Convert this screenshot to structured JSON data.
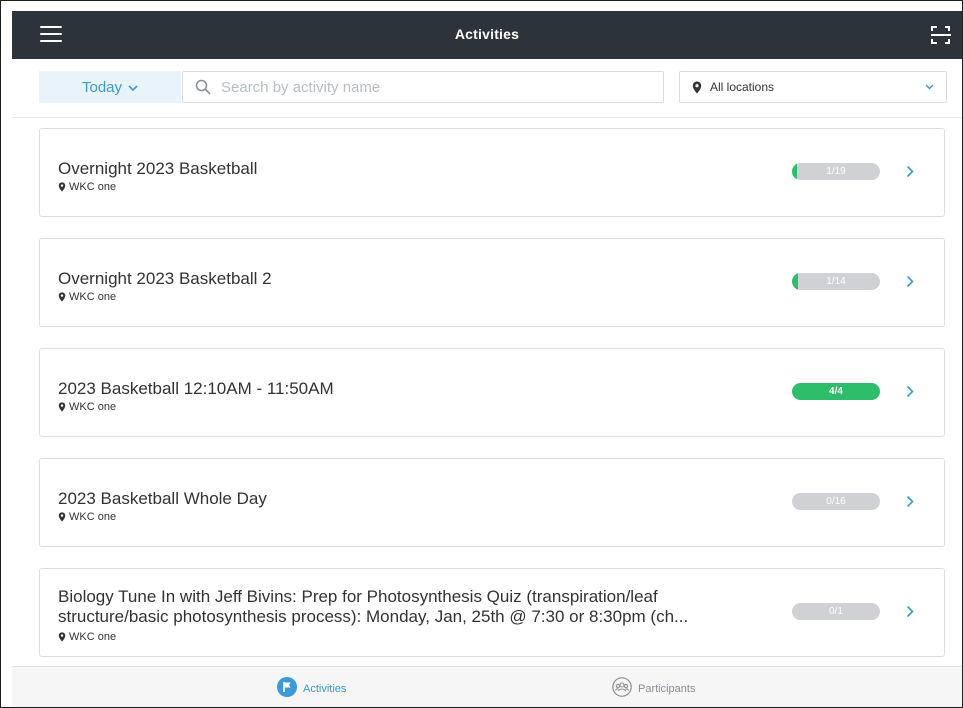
{
  "header": {
    "title": "Activities"
  },
  "filters": {
    "date_label": "Today",
    "search_placeholder": "Search by activity name",
    "location_label": "All locations"
  },
  "activities": [
    {
      "name": "Overnight 2023 Basketball",
      "location": "WKC one",
      "count": "1/19",
      "filled": 1,
      "capacity": 19
    },
    {
      "name": "Overnight 2023 Basketball 2",
      "location": "WKC one",
      "count": "1/14",
      "filled": 1,
      "capacity": 14
    },
    {
      "name": "2023 Basketball 12:10AM - 11:50AM",
      "location": "WKC one",
      "count": "4/4",
      "filled": 4,
      "capacity": 4
    },
    {
      "name": "2023 Basketball Whole Day",
      "location": "WKC one",
      "count": "0/16",
      "filled": 0,
      "capacity": 16
    },
    {
      "name": "Biology Tune In with Jeff Bivins: Prep for Photosynthesis Quiz (transpiration/leaf structure/basic photosynthesis process): Monday, Jan, 25th @ 7:30 or 8:30pm (ch...",
      "location": "WKC one",
      "count": "0/1",
      "filled": 0,
      "capacity": 1
    }
  ],
  "tabs": [
    {
      "label": "Activities",
      "icon": "flag-icon",
      "active": true
    },
    {
      "label": "Participants",
      "icon": "group-icon",
      "active": false
    }
  ],
  "colors": {
    "accent": "#3c9ad8",
    "header_bg": "#2d333b",
    "success": "#2ebd6b",
    "pill_empty": "#cfd1d4"
  }
}
